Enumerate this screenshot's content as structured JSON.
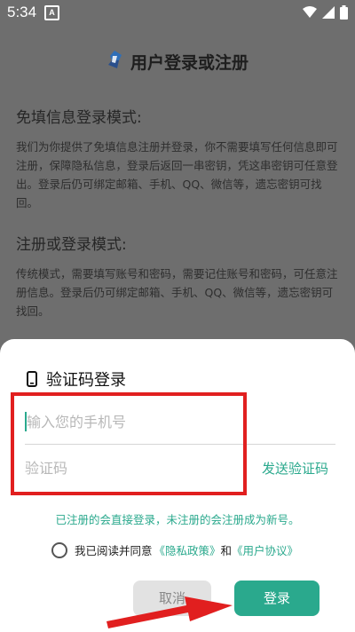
{
  "status_bar": {
    "time": "5:34",
    "notif_letter": "A"
  },
  "header": {
    "title": "用户登录或注册"
  },
  "sections": [
    {
      "title": "免填信息登录模式:",
      "text": "我们为你提供了免填信息注册并登录，你不需要填写任何信息即可注册，保障隐私信息，登录后返回一串密钥，凭这串密钥可任意登出。登录后仍可绑定邮箱、手机、QQ、微信等，遗忘密钥可找回。"
    },
    {
      "title": "注册或登录模式:",
      "text": "传统模式，需要填写账号和密码，需要记住账号和密码，可任意注册信息。登录后仍可绑定邮箱、手机、QQ、微信等，遗忘密钥可找回。"
    }
  ],
  "sheet": {
    "title": "验证码登录",
    "phone_placeholder": "输入您的手机号",
    "code_placeholder": "验证码",
    "send_code": "发送验证码",
    "hint": "已注册的会直接登录，未注册的会注册成为新号。",
    "agree_prefix": "我已阅读并同意",
    "privacy": "《隐私政策》",
    "and": "和",
    "user_agreement": "《用户协议》",
    "cancel": "取消",
    "login": "登录"
  },
  "colors": {
    "accent": "#2aa98d",
    "highlight": "#e11f1f"
  }
}
